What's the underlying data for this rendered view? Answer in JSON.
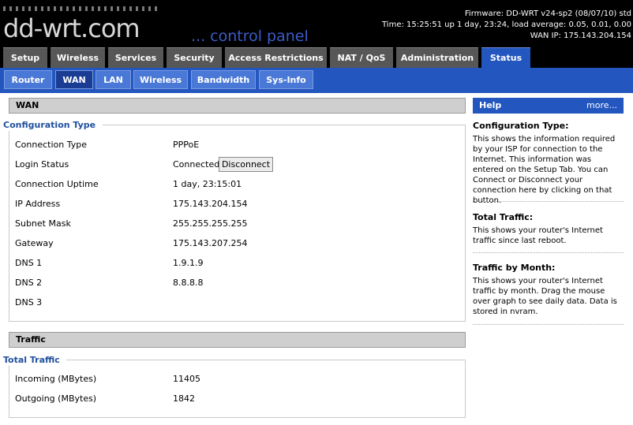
{
  "header": {
    "logo": "dd-wrt.com",
    "tagline": "... control panel",
    "firmware": "Firmware: DD-WRT v24-sp2 (08/07/10) std",
    "time": "Time: 15:25:51 up 1 day, 23:24, load average: 0.05, 0.01, 0.00",
    "wan_ip": "WAN IP: 175.143.204.154"
  },
  "main_tabs": [
    "Setup",
    "Wireless",
    "Services",
    "Security",
    "Access Restrictions",
    "NAT / QoS",
    "Administration",
    "Status"
  ],
  "active_main_tab": "Status",
  "sub_tabs": [
    "Router",
    "WAN",
    "LAN",
    "Wireless",
    "Bandwidth",
    "Sys-Info"
  ],
  "active_sub_tab": "WAN",
  "wan": {
    "section_title": "WAN",
    "config_legend": "Configuration Type",
    "rows": [
      {
        "label": "Connection Type",
        "value": "PPPoE"
      },
      {
        "label": "Login Status",
        "value": "Connected"
      },
      {
        "label": "Connection Uptime",
        "value": "1 day, 23:15:01"
      },
      {
        "label": "IP Address",
        "value": "175.143.204.154"
      },
      {
        "label": "Subnet Mask",
        "value": "255.255.255.255"
      },
      {
        "label": "Gateway",
        "value": "175.143.207.254"
      },
      {
        "label": "DNS 1",
        "value": "1.9.1.9"
      },
      {
        "label": "DNS 2",
        "value": "8.8.8.8"
      },
      {
        "label": "DNS 3",
        "value": ""
      }
    ],
    "disconnect_label": "Disconnect"
  },
  "traffic": {
    "section_title": "Traffic",
    "legend": "Total Traffic",
    "rows": [
      {
        "label": "Incoming (MBytes)",
        "value": "11405"
      },
      {
        "label": "Outgoing (MBytes)",
        "value": "1842"
      }
    ]
  },
  "help": {
    "title": "Help",
    "more": "more...",
    "items": [
      {
        "title": "Configuration Type:",
        "text": "This shows the information required by your ISP for connection to the Internet. This information was entered on the Setup Tab. You can Connect or Disconnect your connection here by clicking on that button."
      },
      {
        "title": "Total Traffic:",
        "text": "This shows your router's Internet traffic since last reboot."
      },
      {
        "title": "Traffic by Month:",
        "text": "This shows your router's Internet traffic by month. Drag the mouse over graph to see daily data. Data is stored in nvram."
      }
    ]
  }
}
